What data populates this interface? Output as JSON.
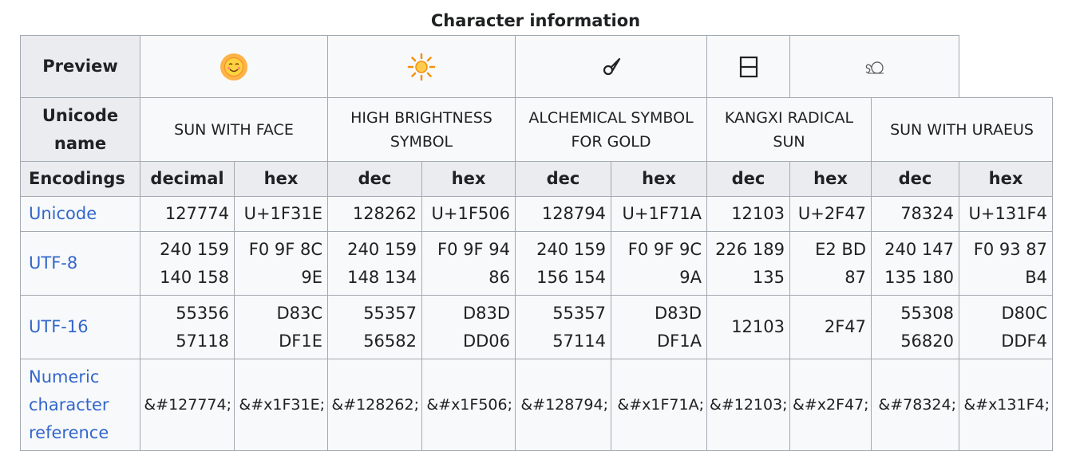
{
  "caption": "Character information",
  "row_headers": {
    "preview": "Preview",
    "unicode_name_line1": "Unicode",
    "unicode_name_line2": "name",
    "encodings": "Encodings",
    "unicode": "Unicode",
    "utf8": "UTF-8",
    "utf16": "UTF-16",
    "ncr_line1": "Numeric",
    "ncr_line2": "character",
    "ncr_line3": "reference"
  },
  "preview_chars": [
    "🌞",
    "🔆",
    "🜚",
    "⼇",
    "𓇴"
  ],
  "names": [
    {
      "l1": "SUN WITH FACE",
      "l2": ""
    },
    {
      "l1": "HIGH BRIGHTNESS",
      "l2": "SYMBOL"
    },
    {
      "l1": "ALCHEMICAL SYMBOL",
      "l2": "FOR GOLD"
    },
    {
      "l1": "KANGXI RADICAL",
      "l2": "SUN"
    },
    {
      "l1": "SUN WITH URAEUS",
      "l2": ""
    }
  ],
  "enc_headers": [
    "decimal",
    "hex",
    "dec",
    "hex",
    "dec",
    "hex",
    "dec",
    "hex",
    "dec",
    "hex"
  ],
  "unicode_row": [
    "127774",
    "U+1F31E",
    "128262",
    "U+1F506",
    "128794",
    "U+1F71A",
    "12103",
    "U+2F47",
    "78324",
    "U+131F4"
  ],
  "utf8_row": [
    [
      "240 159",
      "140 158"
    ],
    [
      "F0 9F 8C",
      "9E"
    ],
    [
      "240 159",
      "148 134"
    ],
    [
      "F0 9F 94",
      "86"
    ],
    [
      "240 159",
      "156 154"
    ],
    [
      "F0 9F 9C",
      "9A"
    ],
    [
      "226 189",
      "135"
    ],
    [
      "E2 BD",
      "87"
    ],
    [
      "240 147",
      "135 180"
    ],
    [
      "F0 93 87",
      "B4"
    ]
  ],
  "utf16_row": [
    [
      "55356",
      "57118"
    ],
    [
      "D83C",
      "DF1E"
    ],
    [
      "55357",
      "56582"
    ],
    [
      "D83D",
      "DD06"
    ],
    [
      "55357",
      "57114"
    ],
    [
      "D83D",
      "DF1A"
    ],
    [
      "12103",
      ""
    ],
    [
      "2F47",
      ""
    ],
    [
      "55308",
      "56820"
    ],
    [
      "D80C",
      "DDF4"
    ]
  ],
  "ncr_row": [
    "&#127774;",
    "&#x1F31E;",
    "&#128262;",
    "&#x1F506;",
    "&#128794;",
    "&#x1F71A;",
    "&#12103;",
    "&#x2F47;",
    "&#78324;",
    "&#x131F4;"
  ]
}
